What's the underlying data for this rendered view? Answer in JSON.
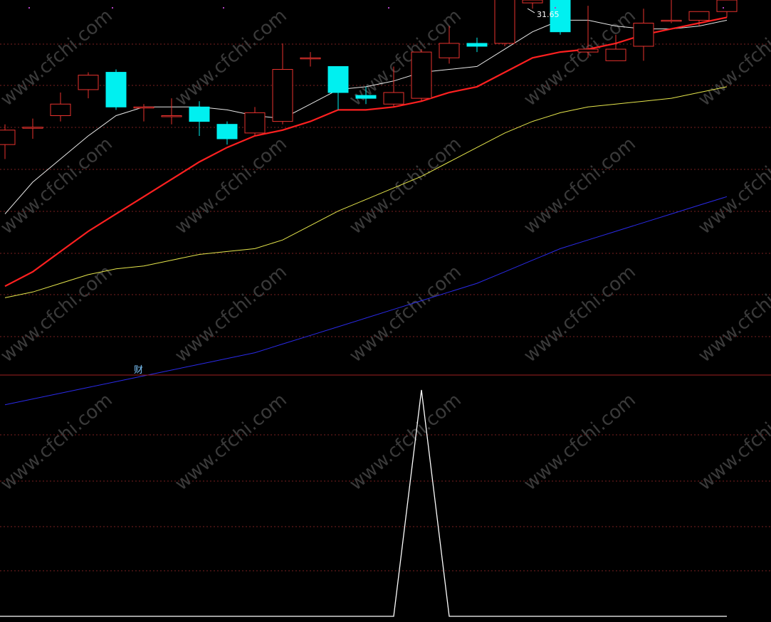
{
  "colors": {
    "background": "#000000",
    "bull": "#e8322e",
    "bear": "#00f0f0",
    "grid": "#7a1f1f",
    "separator": "#a02020",
    "ma5": "#e8e8e8",
    "ma10": "#ff2020",
    "ma20": "#e6e64c",
    "ma60": "#2a2ae8",
    "indicator": "#ffffff",
    "marker": "#b040c0"
  },
  "chart_data": [
    {
      "type": "candlestick",
      "price_range": [
        19.8,
        32.6
      ],
      "max_price_label": "31.65",
      "candles": [
        {
          "o": 27.6,
          "h": 28.3,
          "l": 27.1,
          "c": 28.1
        },
        {
          "o": 28.2,
          "h": 28.5,
          "l": 27.8,
          "c": 28.2
        },
        {
          "o": 28.6,
          "h": 29.4,
          "l": 28.4,
          "c": 29.0
        },
        {
          "o": 29.5,
          "h": 30.1,
          "l": 29.2,
          "c": 30.0
        },
        {
          "o": 30.1,
          "h": 30.2,
          "l": 28.8,
          "c": 28.9
        },
        {
          "o": 28.9,
          "h": 29.0,
          "l": 28.4,
          "c": 28.9
        },
        {
          "o": 28.6,
          "h": 29.2,
          "l": 28.3,
          "c": 28.6
        },
        {
          "o": 28.9,
          "h": 29.1,
          "l": 27.9,
          "c": 28.4
        },
        {
          "o": 28.3,
          "h": 28.4,
          "l": 27.6,
          "c": 27.8
        },
        {
          "o": 28.0,
          "h": 28.9,
          "l": 27.9,
          "c": 28.7
        },
        {
          "o": 28.4,
          "h": 31.1,
          "l": 28.3,
          "c": 30.2
        },
        {
          "o": 30.6,
          "h": 30.8,
          "l": 30.3,
          "c": 30.6
        },
        {
          "o": 30.3,
          "h": 30.3,
          "l": 28.8,
          "c": 29.4
        },
        {
          "o": 29.3,
          "h": 29.6,
          "l": 29.0,
          "c": 29.2
        },
        {
          "o": 29.0,
          "h": 30.3,
          "l": 28.9,
          "c": 29.4
        },
        {
          "o": 29.2,
          "h": 30.9,
          "l": 29.1,
          "c": 30.8
        },
        {
          "o": 30.6,
          "h": 31.7,
          "l": 30.4,
          "c": 31.1
        },
        {
          "o": 31.1,
          "h": 31.3,
          "l": 30.8,
          "c": 31.0
        },
        {
          "o": 31.1,
          "h": 32.9,
          "l": 31.0,
          "c": 32.7
        },
        {
          "o": 32.5,
          "h": 32.8,
          "l": 32.3,
          "c": 32.6
        },
        {
          "o": 32.6,
          "h": 32.8,
          "l": 31.4,
          "c": 31.5
        },
        {
          "o": 30.8,
          "h": 32.4,
          "l": 30.6,
          "c": 30.9
        },
        {
          "o": 30.5,
          "h": 31.4,
          "l": 30.5,
          "c": 30.9
        },
        {
          "o": 31.0,
          "h": 32.3,
          "l": 30.5,
          "c": 31.8
        },
        {
          "o": 31.9,
          "h": 32.7,
          "l": 31.8,
          "c": 31.9
        },
        {
          "o": 31.9,
          "h": 32.1,
          "l": 31.7,
          "c": 32.2
        },
        {
          "o": 32.2,
          "h": 32.6,
          "l": 32.0,
          "c": 32.6
        }
      ],
      "moving_averages": [
        {
          "name": "MA5",
          "values": [
            25.2,
            26.3,
            27.1,
            27.9,
            28.6,
            28.9,
            28.9,
            28.9,
            28.8,
            28.6,
            28.5,
            29.0,
            29.5,
            29.6,
            29.8,
            30.1,
            30.2,
            30.3,
            30.9,
            31.5,
            31.9,
            31.9,
            31.7,
            31.6,
            31.6,
            31.7,
            31.9
          ]
        },
        {
          "name": "MA10",
          "values": [
            22.7,
            23.2,
            23.9,
            24.6,
            25.2,
            25.8,
            26.4,
            27.0,
            27.5,
            27.9,
            28.1,
            28.4,
            28.8,
            28.8,
            28.9,
            29.1,
            29.4,
            29.6,
            30.1,
            30.6,
            30.8,
            30.9,
            31.1,
            31.4,
            31.6,
            31.8,
            32.0
          ]
        },
        {
          "name": "MA20",
          "values": [
            22.3,
            22.5,
            22.8,
            23.1,
            23.3,
            23.4,
            23.6,
            23.8,
            23.9,
            24.0,
            24.3,
            24.8,
            25.3,
            25.7,
            26.1,
            26.5,
            27.0,
            27.5,
            28.0,
            28.4,
            28.7,
            28.9,
            29.0,
            29.1,
            29.2,
            29.4,
            29.6
          ]
        },
        {
          "name": "MA60",
          "values": [
            18.6,
            18.8,
            19.0,
            19.2,
            19.4,
            19.6,
            19.8,
            20.0,
            20.2,
            20.4,
            20.7,
            21.0,
            21.3,
            21.6,
            21.9,
            22.2,
            22.5,
            22.8,
            23.2,
            23.6,
            24.0,
            24.3,
            24.6,
            24.9,
            25.2,
            25.5,
            25.8
          ]
        }
      ]
    },
    {
      "type": "line",
      "label": "财",
      "range": [
        0,
        1
      ],
      "values": [
        0,
        0,
        0,
        0,
        0,
        0,
        0,
        0,
        0,
        0,
        0,
        0,
        0,
        0,
        0,
        1,
        0,
        0,
        0,
        0,
        0,
        0,
        0,
        0,
        0,
        0,
        0
      ]
    }
  ],
  "watermark": "www.cfchi.com"
}
